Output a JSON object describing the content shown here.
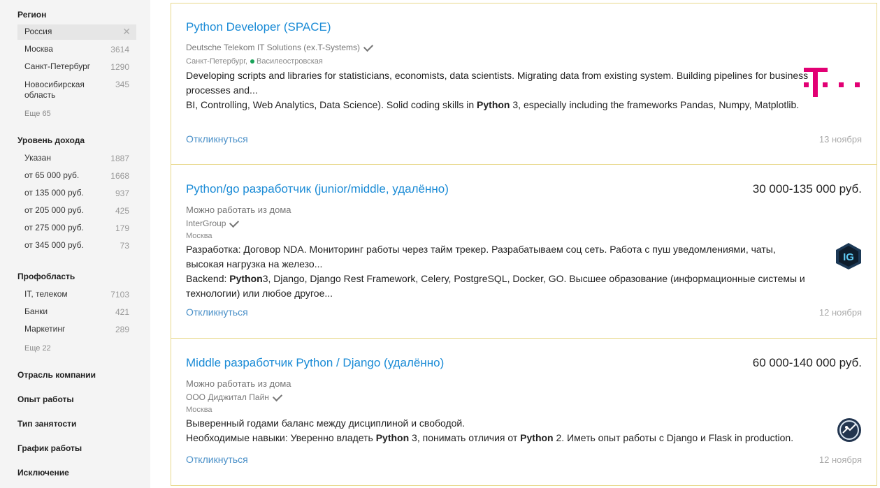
{
  "sidebar": {
    "region": {
      "title": "Регион",
      "items": [
        {
          "label": "Россия",
          "count": ""
        },
        {
          "label": "Москва",
          "count": "3614"
        },
        {
          "label": "Санкт-Петербург",
          "count": "1290"
        },
        {
          "label": "Новосибирская область",
          "count": "345"
        }
      ],
      "more": "Еще 65"
    },
    "income": {
      "title": "Уровень дохода",
      "items": [
        {
          "label": "Указан",
          "count": "1887"
        },
        {
          "label": "от 65 000 руб.",
          "count": "1668"
        },
        {
          "label": "от 135 000 руб.",
          "count": "937"
        },
        {
          "label": "от 205 000 руб.",
          "count": "425"
        },
        {
          "label": "от 275 000 руб.",
          "count": "179"
        },
        {
          "label": "от 345 000 руб.",
          "count": "73"
        }
      ]
    },
    "profarea": {
      "title": "Профобласть",
      "items": [
        {
          "label": "IT, телеком",
          "count": "7103"
        },
        {
          "label": "Банки",
          "count": "421"
        },
        {
          "label": "Маркетинг",
          "count": "289"
        }
      ],
      "more": "Еще 22"
    },
    "collapsed": [
      "Отрасль компании",
      "Опыт работы",
      "Тип занятости",
      "График работы",
      "Исключение"
    ]
  },
  "vacancies": [
    {
      "title": "Python Developer (SPACE)",
      "salary": "",
      "company": "Deutsche Telekom IT Solutions (ex.T-Systems)",
      "city": "Санкт-Петербург,",
      "metro": "Василеостровская",
      "line1": "Developing scripts and libraries for statisticians, economists, data scientists. Migrating data from existing system. Building pipelines for business processes and...",
      "line2a": "BI, Controlling, Web Analytics, Data Science). Solid coding skills in ",
      "line2b": "Python",
      "line2c": " 3, especially including the frameworks Pandas, Numpy, Matplotlib.",
      "respond": "Откликнуться",
      "date": "13 ноября",
      "logo_text": "T · ·",
      "logo_color": "#e20074"
    },
    {
      "title": "Python/go разработчик (junior/middle, удалённо)",
      "salary": "30 000-135 000 руб.",
      "remote": "Можно работать из дома",
      "company": "InterGroup",
      "city": "Москва",
      "line1": "Разработка: Договор NDA. Мониторинг работы через тайм трекер. Разрабатываем соц сеть. Работа с пуш уведомлениями, чаты, высокая нагрузка на железо...",
      "line2a": "Backend: ",
      "line2b": "Python",
      "line2c": "3, Django, Django Rest Framework, Celery, PostgreSQL, Docker, GO. Высшее образование (информационные системы и технологии) или любое другое...",
      "respond": "Откликнуться",
      "date": "12 ноября",
      "logo_text": "IG"
    },
    {
      "title": "Middle разработчик Python / Django (удалённо)",
      "salary": "60 000-140 000 руб.",
      "remote": "Можно работать из дома",
      "company": "ООО Диджитал Пайн",
      "city": "Москва",
      "line1": "Выверенный годами баланс между дисциплиной и свободой.",
      "line2a": "Необходимые навыки: Уверенно владеть ",
      "line2b": "Python",
      "line2c": " 3, понимать отличия от ",
      "line2d": "Python",
      "line2e": " 2. Иметь опыт работы с Django и Flask in production.",
      "respond": "Откликнуться",
      "date": "12 ноября"
    }
  ]
}
